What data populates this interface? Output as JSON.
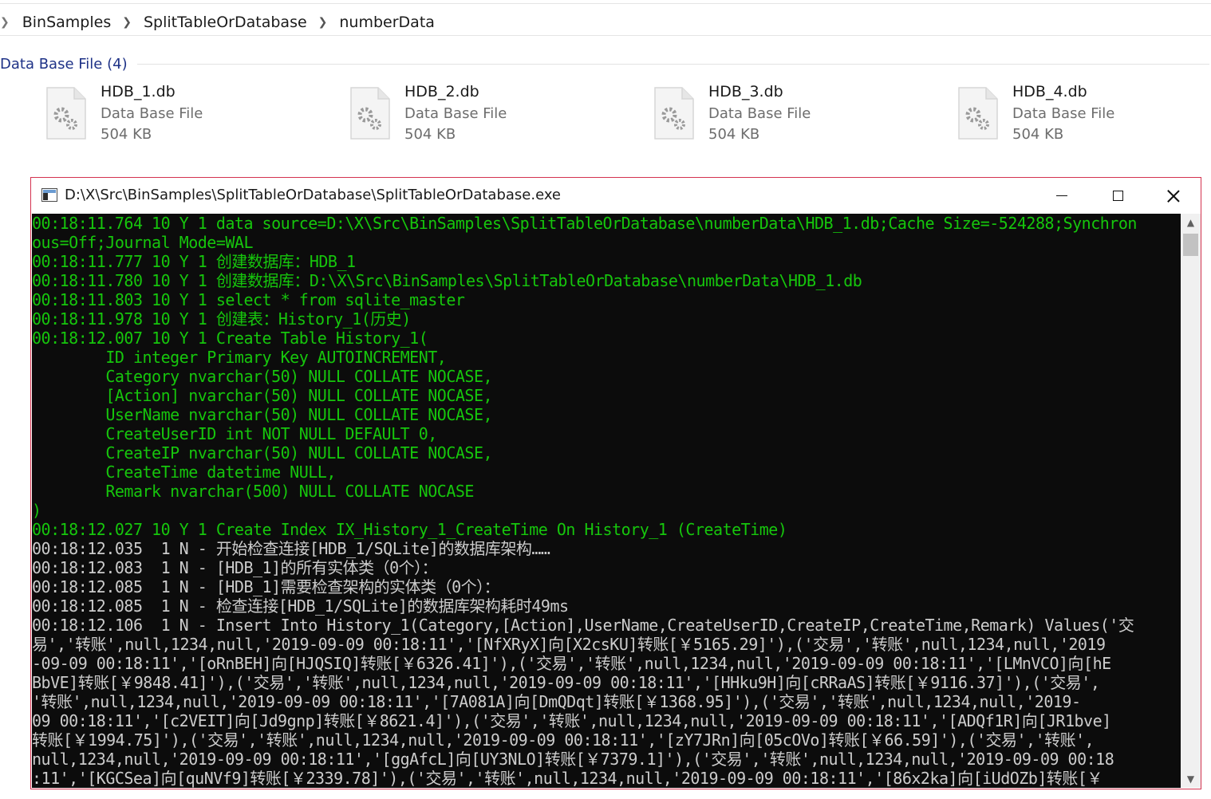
{
  "breadcrumb": {
    "items": [
      "BinSamples",
      "SplitTableOrDatabase",
      "numberData"
    ]
  },
  "group": {
    "title": "Data Base File (4)"
  },
  "files": [
    {
      "name": "HDB_1.db",
      "type": "Data Base File",
      "size": "504 KB"
    },
    {
      "name": "HDB_2.db",
      "type": "Data Base File",
      "size": "504 KB"
    },
    {
      "name": "HDB_3.db",
      "type": "Data Base File",
      "size": "504 KB"
    },
    {
      "name": "HDB_4.db",
      "type": "Data Base File",
      "size": "504 KB"
    }
  ],
  "console": {
    "title": "D:\\X\\Src\\BinSamples\\SplitTableOrDatabase\\SplitTableOrDatabase.exe",
    "lines": [
      {
        "text": "00:18:11.764 10 Y 1 data source=D:\\X\\Src\\BinSamples\\SplitTableOrDatabase\\numberData\\HDB_1.db;Cache Size=-524288;Synchron",
        "color": "green"
      },
      {
        "text": "ous=Off;Journal Mode=WAL",
        "color": "green"
      },
      {
        "text": "00:18:11.777 10 Y 1 创建数据库：HDB_1",
        "color": "green"
      },
      {
        "text": "00:18:11.780 10 Y 1 创建数据库：D:\\X\\Src\\BinSamples\\SplitTableOrDatabase\\numberData\\HDB_1.db",
        "color": "green"
      },
      {
        "text": "00:18:11.803 10 Y 1 select * from sqlite_master",
        "color": "green"
      },
      {
        "text": "00:18:11.978 10 Y 1 创建表：History_1(历史)",
        "color": "green"
      },
      {
        "text": "00:18:12.007 10 Y 1 Create Table History_1(",
        "color": "green"
      },
      {
        "text": "        ID integer Primary Key AUTOINCREMENT,",
        "color": "green"
      },
      {
        "text": "        Category nvarchar(50) NULL COLLATE NOCASE,",
        "color": "green"
      },
      {
        "text": "        [Action] nvarchar(50) NULL COLLATE NOCASE,",
        "color": "green"
      },
      {
        "text": "        UserName nvarchar(50) NULL COLLATE NOCASE,",
        "color": "green"
      },
      {
        "text": "        CreateUserID int NOT NULL DEFAULT 0,",
        "color": "green"
      },
      {
        "text": "        CreateIP nvarchar(50) NULL COLLATE NOCASE,",
        "color": "green"
      },
      {
        "text": "        CreateTime datetime NULL,",
        "color": "green"
      },
      {
        "text": "        Remark nvarchar(500) NULL COLLATE NOCASE",
        "color": "green"
      },
      {
        "text": ")",
        "color": "green"
      },
      {
        "text": "00:18:12.027 10 Y 1 Create Index IX_History_1_CreateTime On History_1 (CreateTime)",
        "color": "green"
      },
      {
        "text": "00:18:12.035  1 N - 开始检查连接[HDB_1/SQLite]的数据库架构……",
        "color": "white"
      },
      {
        "text": "00:18:12.083  1 N - [HDB_1]的所有实体类（0个）：",
        "color": "white"
      },
      {
        "text": "00:18:12.085  1 N - [HDB_1]需要检查架构的实体类（0个）：",
        "color": "white"
      },
      {
        "text": "00:18:12.085  1 N - 检查连接[HDB_1/SQLite]的数据库架构耗时49ms",
        "color": "white"
      },
      {
        "text": "00:18:12.106  1 N - Insert Into History_1(Category,[Action],UserName,CreateUserID,CreateIP,CreateTime,Remark) Values('交",
        "color": "white"
      },
      {
        "text": "易','转账',null,1234,null,'2019-09-09 00:18:11','[NfXRyX]向[X2csKU]转账[￥5165.29]'),('交易','转账',null,1234,null,'2019",
        "color": "white"
      },
      {
        "text": "-09-09 00:18:11','[oRnBEH]向[HJQSIQ]转账[￥6326.41]'),('交易','转账',null,1234,null,'2019-09-09 00:18:11','[LMnVCO]向[hE",
        "color": "white"
      },
      {
        "text": "BbVE]转账[￥9848.41]'),('交易','转账',null,1234,null,'2019-09-09 00:18:11','[HHku9H]向[cRRaAS]转账[￥9116.37]'),('交易',",
        "color": "white"
      },
      {
        "text": "'转账',null,1234,null,'2019-09-09 00:18:11','[7A081A]向[DmQDqt]转账[￥1368.95]'),('交易','转账',null,1234,null,'2019-",
        "color": "white"
      },
      {
        "text": "09 00:18:11','[c2VEIT]向[Jd9gnp]转账[￥8621.4]'),('交易','转账',null,1234,null,'2019-09-09 00:18:11','[ADQf1R]向[JR1bve]",
        "color": "white"
      },
      {
        "text": "转账[￥1994.75]'),('交易','转账',null,1234,null,'2019-09-09 00:18:11','[zY7JRn]向[05cOVo]转账[￥66.59]'),('交易','转账',",
        "color": "white"
      },
      {
        "text": "null,1234,null,'2019-09-09 00:18:11','[ggAfcL]向[UY3NLO]转账[￥7379.1]'),('交易','转账',null,1234,null,'2019-09-09 00:18",
        "color": "white"
      },
      {
        "text": ":11','[KGCSea]向[quNVf9]转账[￥2339.78]'),('交易','转账',null,1234,null,'2019-09-09 00:18:11','[86x2ka]向[iUdOZb]转账[￥",
        "color": "white"
      }
    ]
  },
  "colors": {
    "console_bg": "#0c0c0c",
    "console_green": "#16c60c",
    "console_white": "#cccccc",
    "group_title": "#1e3287",
    "window_border": "#d4324f"
  },
  "icons": {
    "file": "gear-document-icon",
    "minimize": "minimize-icon",
    "maximize": "maximize-icon",
    "close": "close-icon"
  }
}
